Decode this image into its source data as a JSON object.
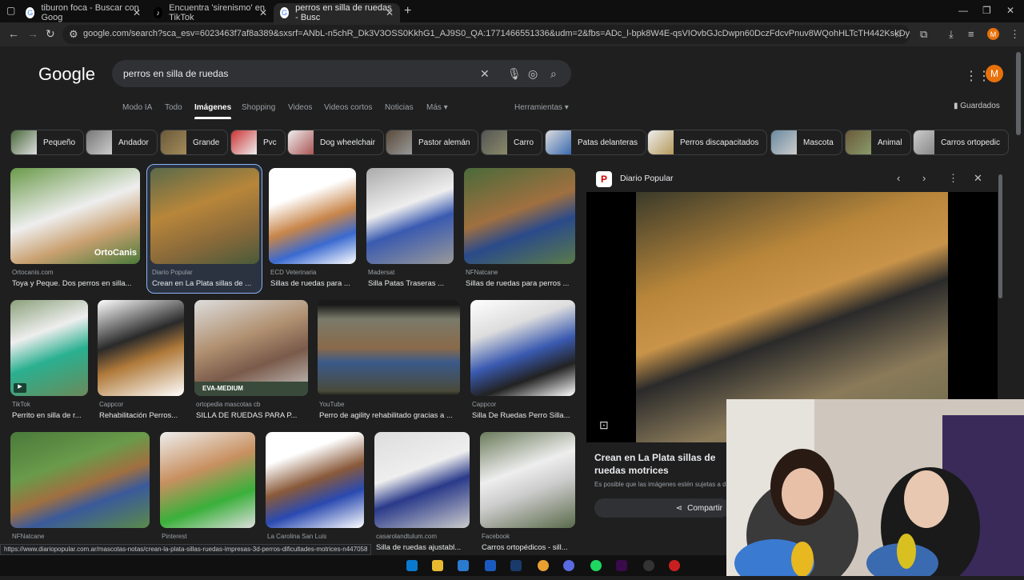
{
  "browser": {
    "tabs": [
      {
        "title": "tiburon foca - Buscar con Goog"
      },
      {
        "title": "Encuentra 'sirenismo' en TikTok"
      },
      {
        "title": "perros en silla de ruedas - Busc"
      }
    ],
    "url": "google.com/search?sca_esv=6023463f7af8a389&sxsrf=ANbL-n5chR_Dk3V3OSS0KkhG1_AJ9S0_QA:1771466551336&udm=2&fbs=ADc_l-bpk8W4E-qsVIOvbGJcDwpn60DczFdcvPnuv8WQohHLTcTH442KskDyC74HpRHrYUorhqIWu6eEEK7aBAtTZ...",
    "profile_initial": "M"
  },
  "google": {
    "logo": "Google",
    "query": "perros en silla de ruedas",
    "profile_initial": "M",
    "nav_tabs": [
      "Modo IA",
      "Todo",
      "Imágenes",
      "Shopping",
      "Videos",
      "Videos cortos",
      "Noticias",
      "Más ▾"
    ],
    "tools": "Herramientas ▾",
    "saved": "Guardados",
    "chips": [
      "Pequeño",
      "Andador",
      "Grande",
      "Pvc",
      "Dog wheelchair",
      "Pastor alemán",
      "Carro",
      "Patas delanteras",
      "Perros discapacitados",
      "Mascota",
      "Animal",
      "Carros ortopedic"
    ]
  },
  "results": [
    {
      "source": "Ortocanis.com",
      "title": "Toya y Peque. Dos perros en silla..."
    },
    {
      "source": "Diario Popular",
      "title": "Crean en La Plata sillas de ..."
    },
    {
      "source": "ECD Veterinaria",
      "title": "Sillas de ruedas para ..."
    },
    {
      "source": "Madersat",
      "title": "Silla Patas Traseras ..."
    },
    {
      "source": "NFNatcane",
      "title": "Sillas de ruedas para perros ..."
    },
    {
      "source": "TikTok",
      "title": "Perrito en silla de r..."
    },
    {
      "source": "Cappcor",
      "title": "Rehabilitación Perros..."
    },
    {
      "source": "ortopedia mascotas cb",
      "title": "SILLA DE RUEDAS PARA P..."
    },
    {
      "source": "YouTube",
      "title": "Perro de agility rehabilitado gracias a ..."
    },
    {
      "source": "Cappcor",
      "title": "Silla De Ruedas Perro Silla..."
    },
    {
      "source": "NFNatcane",
      "title": ""
    },
    {
      "source": "Pinterest",
      "title": ""
    },
    {
      "source": "La Carolina San Luis",
      "title": ""
    },
    {
      "source": "casarolandtulum.com",
      "title": "Silla de ruedas ajustabl..."
    },
    {
      "source": "Facebook",
      "title": "Carros ortopédicos - sill..."
    }
  ],
  "overlay_labels": {
    "orto": "OrtoCanis",
    "eva": "EVA-MEDIUM"
  },
  "panel": {
    "source": "Diario Popular",
    "title": "Crean en La Plata sillas de ruedas motrices",
    "note": "Es posible que las imágenes estén sujetas a d",
    "share": "Compartir"
  },
  "status_url": "https://www.diariopopular.com.ar/mascotas-notas/crean-la-plata-sillas-ruedas-impresas-3d-perros-dificultades-motrices-n447058",
  "colors": {
    "bg": "#1f1f1f",
    "accent": "#8ab4f8",
    "profile": "#e8710a"
  }
}
